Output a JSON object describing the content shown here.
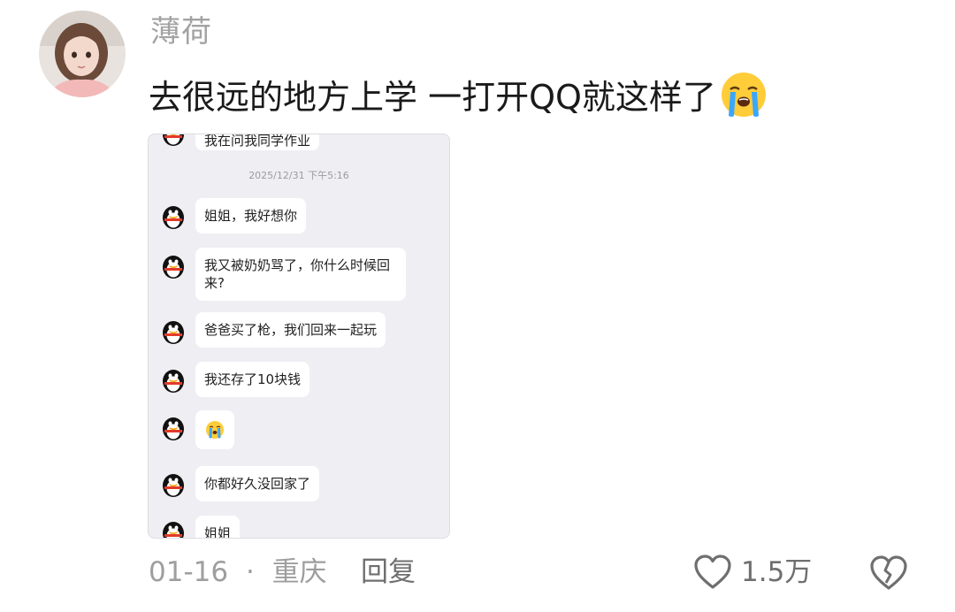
{
  "comment": {
    "username": "薄荷",
    "text": "去很远的地方上学 一打开QQ就这样了",
    "emoji": "loudly-crying-face-icon"
  },
  "attached_chat": {
    "partial_top_message": "我在问我同学作业",
    "timestamp": "2025/12/31 下午5:16",
    "messages": [
      {
        "text": "姐姐，我好想你"
      },
      {
        "text": "我又被奶奶骂了，你什么时候回来?"
      },
      {
        "text": "爸爸买了枪，我们回来一起玩"
      },
      {
        "text": "我还存了10块钱"
      },
      {
        "text": "",
        "sticker": "crying-sticker-icon"
      },
      {
        "text": "你都好久没回家了"
      },
      {
        "text": "姐姐"
      }
    ],
    "avatar_icon": "qq-penguin-icon"
  },
  "footer": {
    "date": "01-16",
    "separator": "·",
    "location": "重庆",
    "reply_label": "回复",
    "like_count": "1.5万",
    "like_icon": "heart-outline-icon",
    "dislike_icon": "broken-heart-icon"
  },
  "colors": {
    "username": "#a3a3a3",
    "text": "#1a1a1a",
    "meta": "#9e9e9e",
    "chat_background": "#efeef3",
    "bubble": "#ffffff"
  }
}
